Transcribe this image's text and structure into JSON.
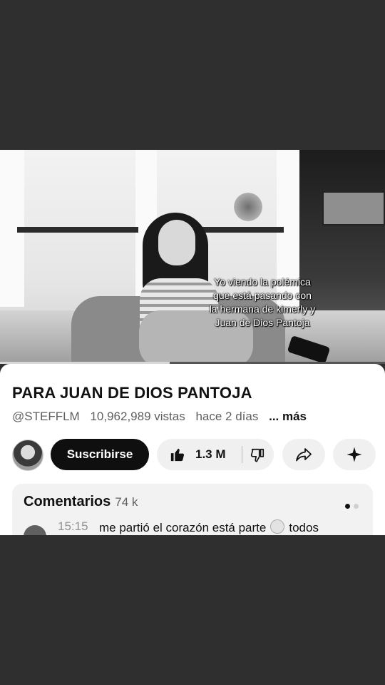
{
  "video": {
    "caption": "Yo viendo la polémica\nque está pasando con\nla hermana de kimerly y\nJuan de Dios Pantoja",
    "progress_fraction": 0.44
  },
  "info": {
    "title": "PARA JUAN DE DIOS PANTOJA",
    "channel": "@STEFFLM",
    "views": "10,962,989 vistas",
    "age": "hace 2 días",
    "more": "... más"
  },
  "actions": {
    "subscribe_label": "Suscribirse",
    "likes": "1.3 M",
    "icons": [
      "thumbs-up-icon",
      "thumbs-down-icon",
      "share-icon",
      "remix-sparkle-icon"
    ]
  },
  "comments": {
    "label": "Comentarios",
    "count": "74 k",
    "first": {
      "timestamp": "15:15",
      "text_before": "me partió el corazón está parte",
      "text_after": "todos"
    }
  },
  "colors": {
    "background": "#2f2f2f",
    "panel": "#ffffff",
    "subscribe_bg": "#0f0f0f",
    "chip_bg": "#f0f0f0"
  }
}
